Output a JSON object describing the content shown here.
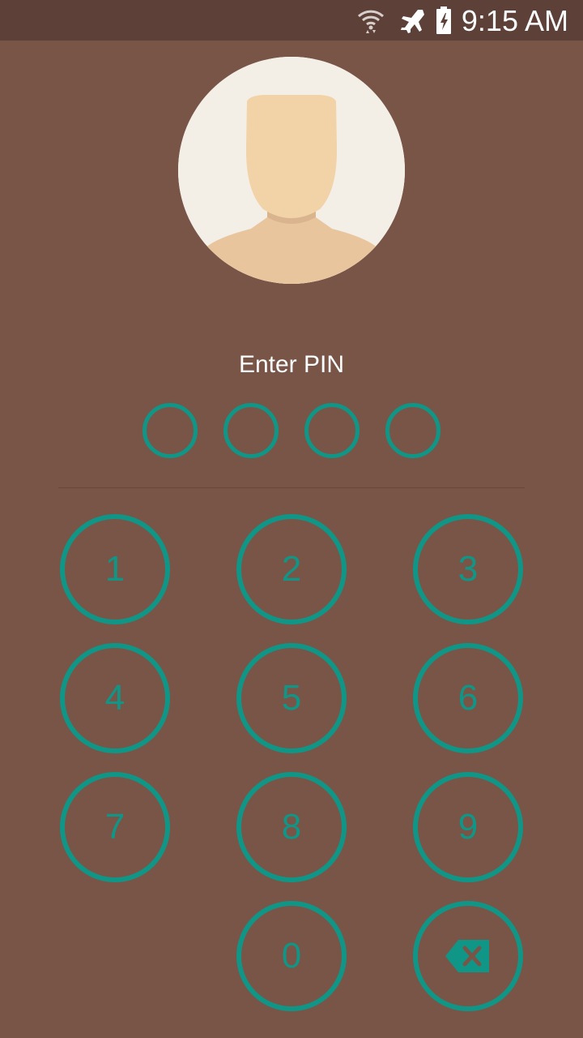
{
  "status_bar": {
    "time": "9:15 AM",
    "icons": [
      "wifi-icon",
      "airplane-mode-icon",
      "battery-charging-icon"
    ]
  },
  "lock_screen": {
    "avatar_icon": "default-user-avatar-icon",
    "prompt": "Enter PIN",
    "pin_length": 4,
    "pin_entered": 0
  },
  "keypad": {
    "keys": [
      "1",
      "2",
      "3",
      "4",
      "5",
      "6",
      "7",
      "8",
      "9",
      "0"
    ],
    "backspace_icon": "backspace-icon"
  },
  "colors": {
    "background": "#795548",
    "status_bar": "#5d4037",
    "accent": "#0f9687",
    "text": "#ffffff"
  }
}
